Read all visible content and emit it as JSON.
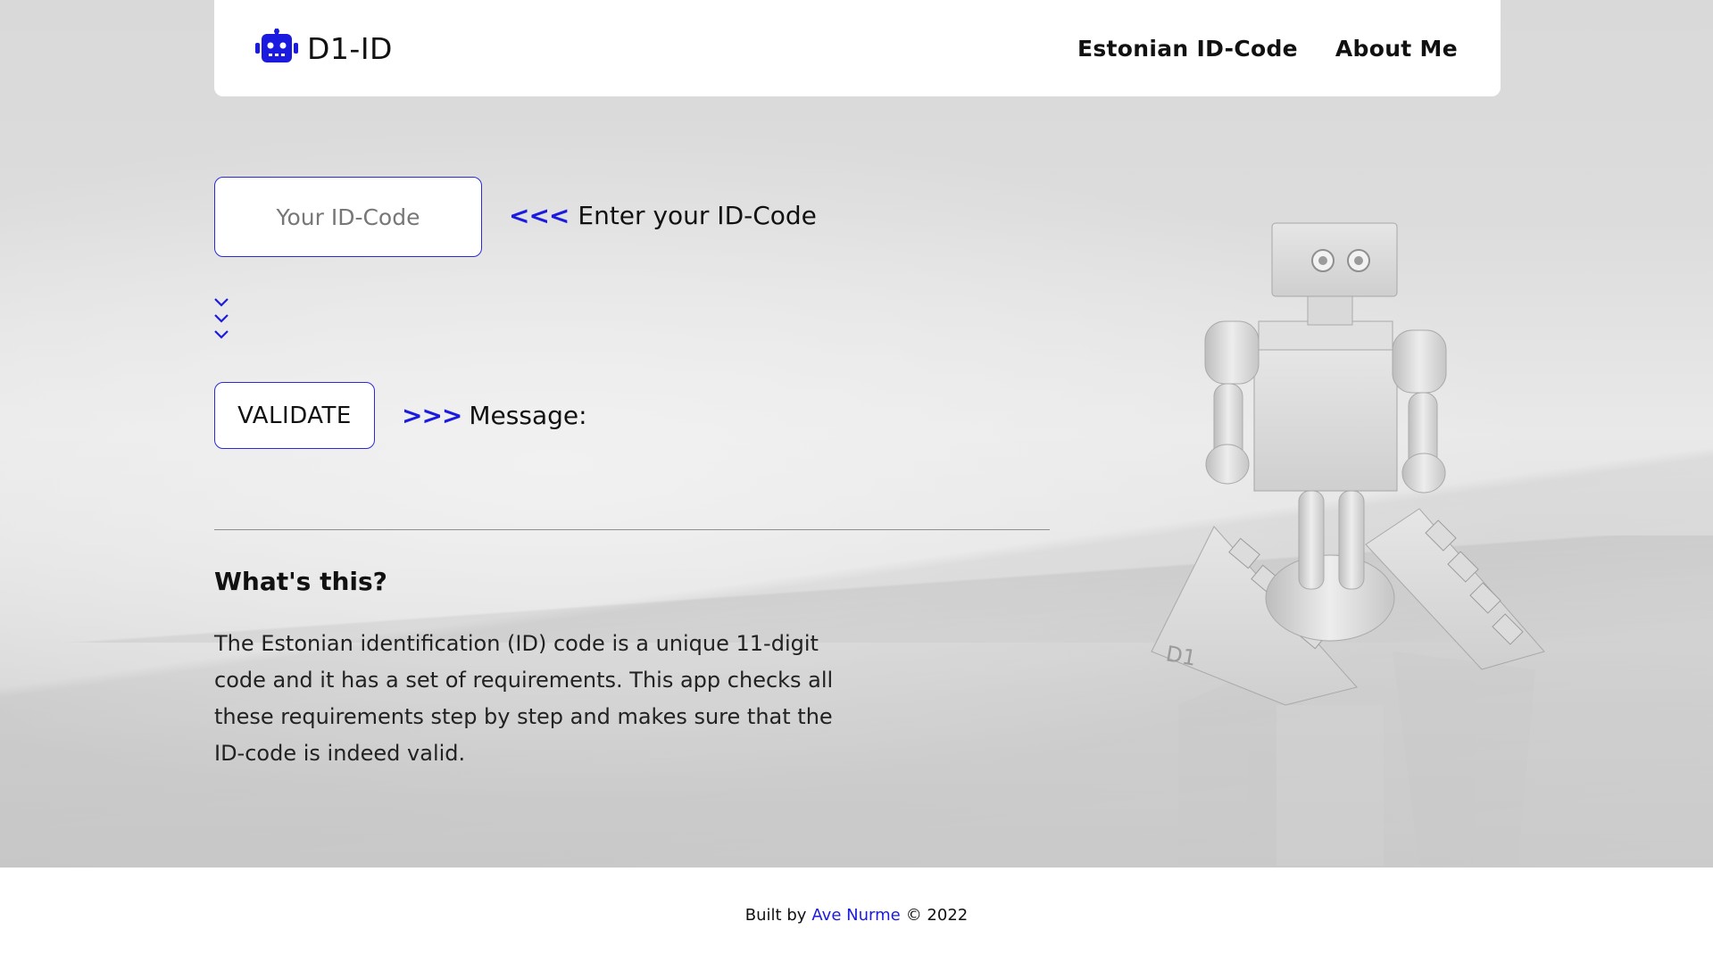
{
  "brand": {
    "name": "D1-ID",
    "icon": "robot-icon",
    "accent": "#1b1be0"
  },
  "nav": {
    "links": [
      "Estonian ID-Code",
      "About Me"
    ]
  },
  "form": {
    "input_placeholder": "Your ID-Code",
    "input_value": "",
    "prompt_arrows": "<<<",
    "prompt_text": "Enter your ID-Code",
    "validate_label": "VALIDATE",
    "message_arrows": ">>>",
    "message_label": "Message:"
  },
  "about": {
    "title": "What's this?",
    "body": "The Estonian identification (ID) code is a unique 11-digit code and it has a set of requirements. This app checks all these requirements step by step and makes sure that the ID-code is indeed valid."
  },
  "footer": {
    "prefix": "Built by",
    "author": "Ave Nurme",
    "suffix": "© 2022"
  }
}
